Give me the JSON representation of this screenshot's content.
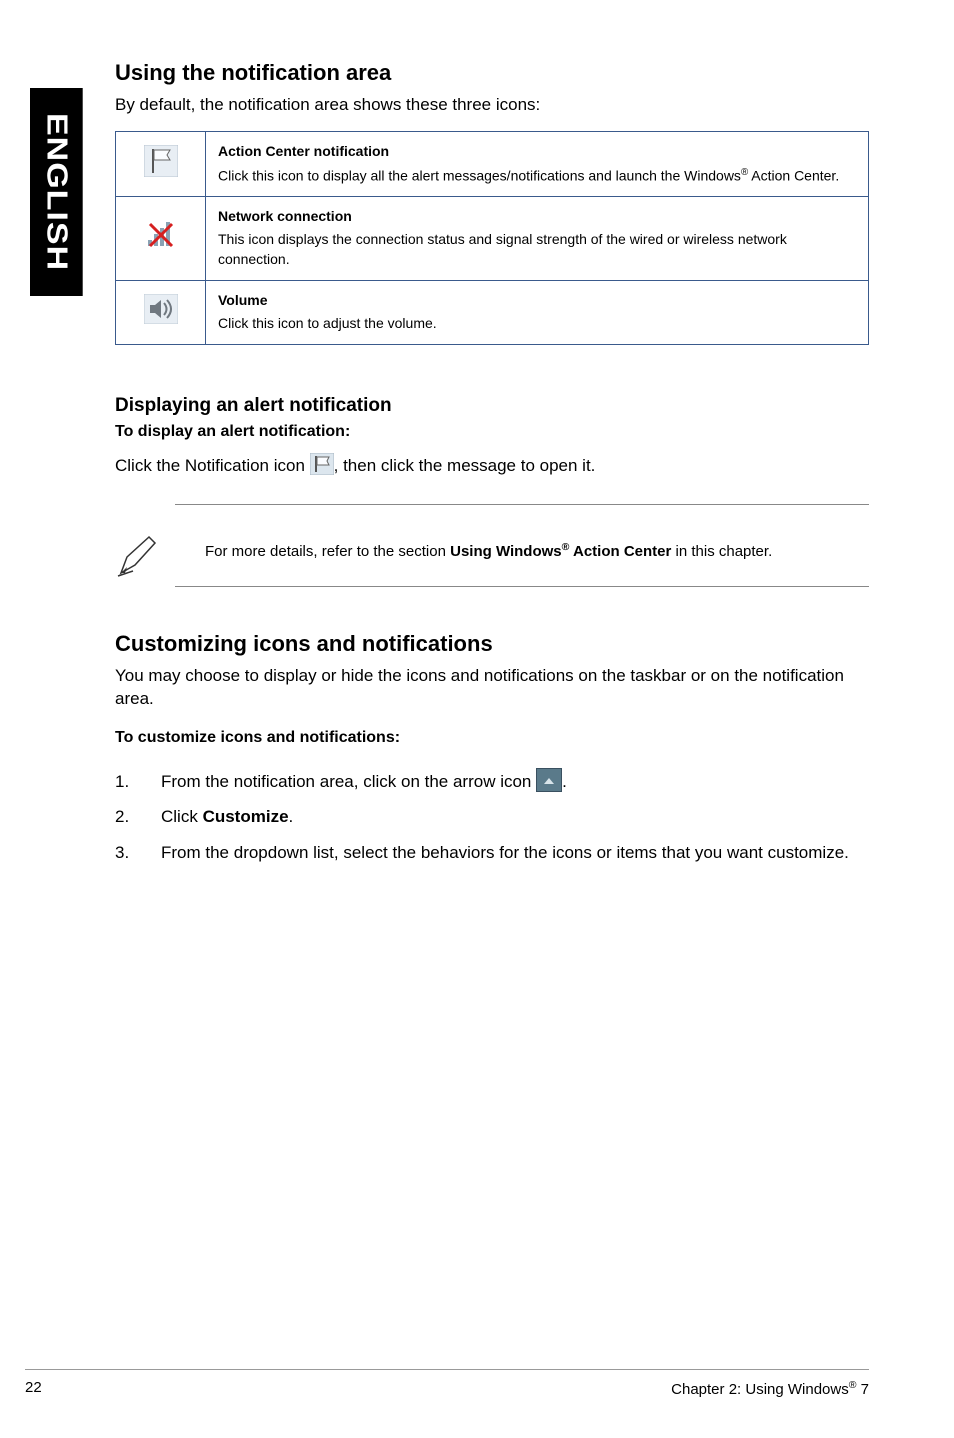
{
  "sideTab": "ENGLISH",
  "section1": {
    "heading": "Using the notification area",
    "intro": "By default, the notification area shows these three icons:",
    "rows": [
      {
        "icon": "flag-icon",
        "title": "Action Center notification",
        "desc_a": "Click this icon to display all the alert messages/notifications and launch the Windows",
        "desc_b": " Action Center."
      },
      {
        "icon": "network-icon",
        "title": "Network connection",
        "desc": "This icon displays the connection status and signal strength of the wired or wireless network connection."
      },
      {
        "icon": "volume-icon",
        "title": "Volume",
        "desc": "Click this icon to adjust the volume."
      }
    ]
  },
  "section2": {
    "heading": "Displaying an alert notification",
    "boldline": "To display an alert notification:",
    "line_a": "Click the Notification icon ",
    "line_b": ", then click the message to open it."
  },
  "note": {
    "text_a": "For more details, refer to the section ",
    "bold_a": "Using Windows",
    "bold_b": " Action Center",
    "text_b": " in this chapter."
  },
  "section3": {
    "heading": "Customizing icons and notifications",
    "intro": "You may choose to display or hide the icons and notifications on the taskbar or on the notification area.",
    "boldline": "To customize icons and notifications:",
    "steps": {
      "s1_a": "From the notification area, click on the arrow icon ",
      "s1_b": ".",
      "s2_a": "Click ",
      "s2_bold": "Customize",
      "s2_b": ".",
      "s3": "From the dropdown list, select the behaviors for the icons or items that you want customize."
    }
  },
  "footer": {
    "page": "22",
    "chapter_a": "Chapter 2: Using Windows",
    "chapter_b": " 7"
  }
}
